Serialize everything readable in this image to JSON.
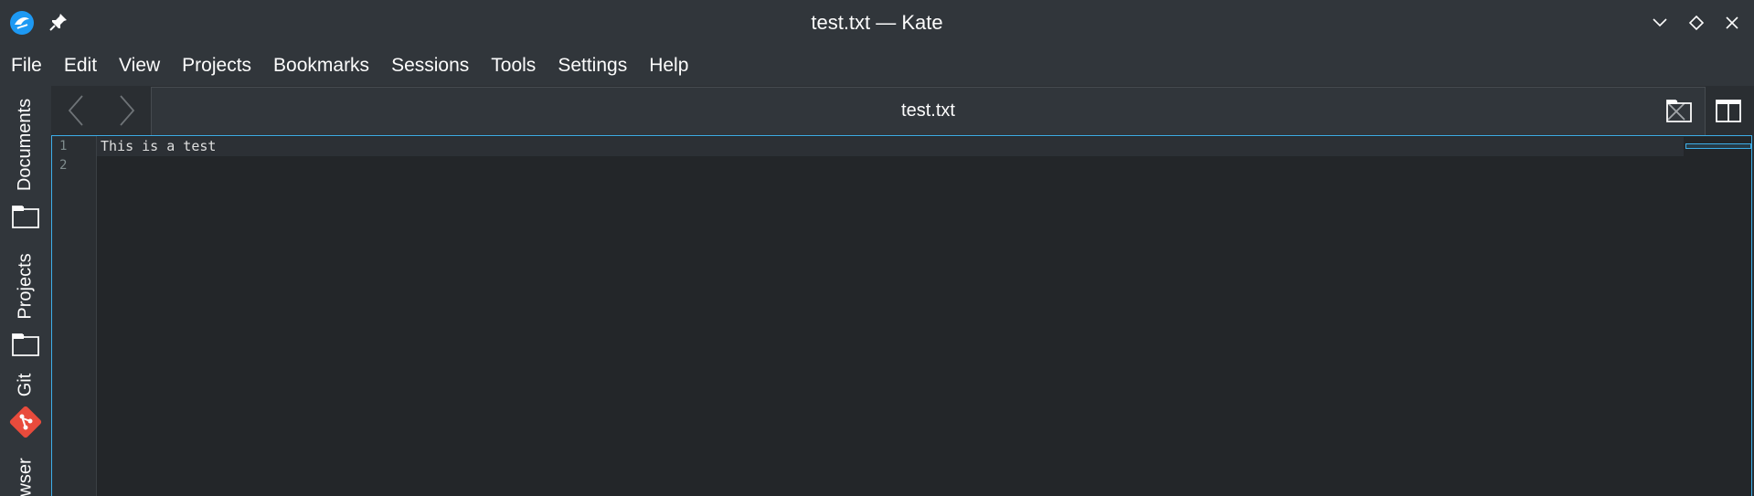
{
  "window": {
    "title": "test.txt — Kate"
  },
  "menubar": {
    "items": [
      "File",
      "Edit",
      "View",
      "Projects",
      "Bookmarks",
      "Sessions",
      "Tools",
      "Settings",
      "Help"
    ]
  },
  "sidebar": {
    "documents_label": "Documents",
    "projects_label": "Projects",
    "git_label": "Git",
    "browser_label": "wser"
  },
  "tabs": {
    "active_label": "test.txt"
  },
  "editor": {
    "line_numbers": [
      "1",
      "2"
    ],
    "lines": [
      "This is a test",
      ""
    ]
  },
  "colors": {
    "accent": "#3daee9",
    "titlebar_bg": "#31363b",
    "editor_bg": "#232629",
    "git_icon": "#e84b3c"
  },
  "icons": {
    "app": "kate-app-icon",
    "pin": "pin-icon",
    "minimize": "chevron-down-icon",
    "maximize": "diamond-icon",
    "close": "close-icon",
    "back": "chevron-left-icon",
    "forward": "chevron-right-icon",
    "tab_close": "close-icon",
    "quick_open": "folder-tab-icon",
    "split_view": "split-view-icon",
    "documents": "folder-icon",
    "projects": "folder-icon",
    "git": "git-icon"
  }
}
